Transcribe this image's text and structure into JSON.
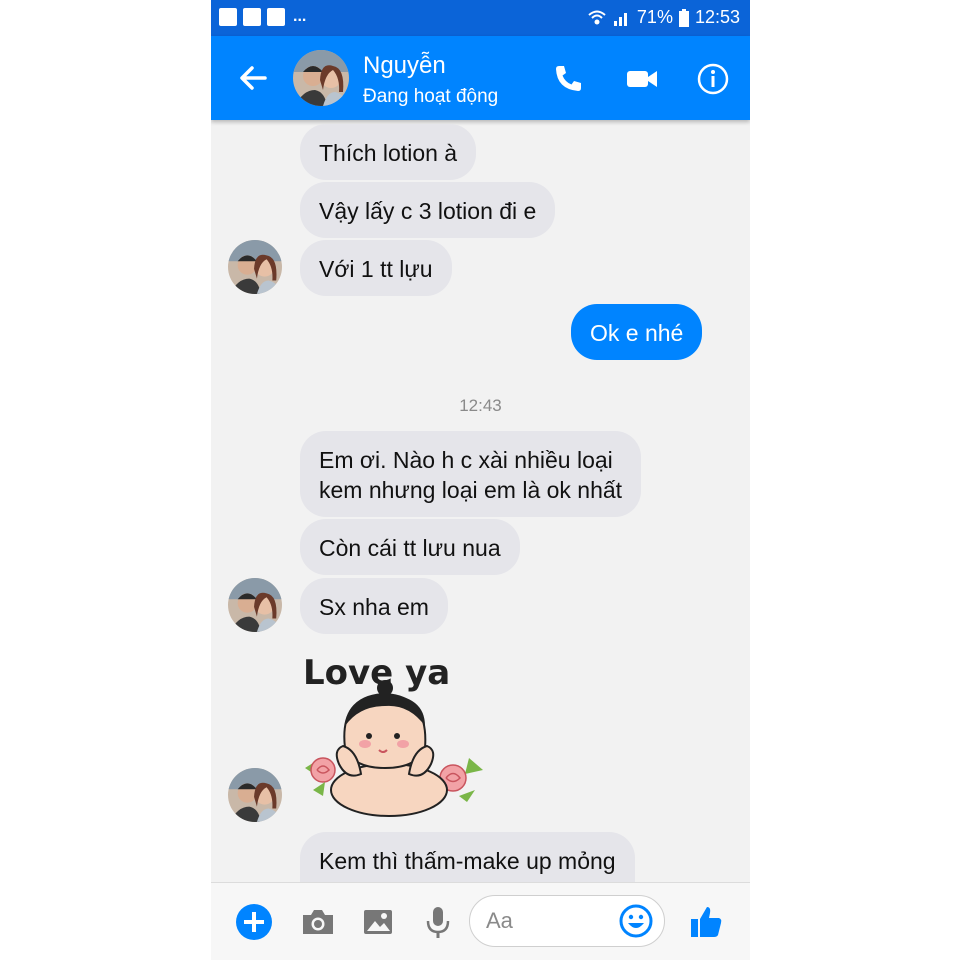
{
  "status_bar": {
    "battery": "71%",
    "time": "12:53",
    "overflow": "..."
  },
  "header": {
    "name": "Nguyễn",
    "status": "Đang hoạt động"
  },
  "messages": {
    "m1": "Thích lotion à",
    "m2": "Vậy lấy c 3 lotion đi e",
    "m3": "Với 1 tt lựu",
    "m4": "Ok e nhé",
    "timestamp": "12:43",
    "m5_line1": "Em ơi. Nào h c xài nhiều loại",
    "m5_line2": "kem nhưng loại em là ok nhất",
    "m6": "Còn cái tt lưu nua",
    "m7": "Sx nha em",
    "sticker_text": "Love ya",
    "m8": "Kem thì thấm-make up mỏng"
  },
  "composer": {
    "placeholder": "Aa"
  },
  "colors": {
    "status_bar": "#0b64d8",
    "header": "#0084ff",
    "incoming_bubble": "#e5e5ea",
    "outgoing_bubble": "#0084ff"
  }
}
